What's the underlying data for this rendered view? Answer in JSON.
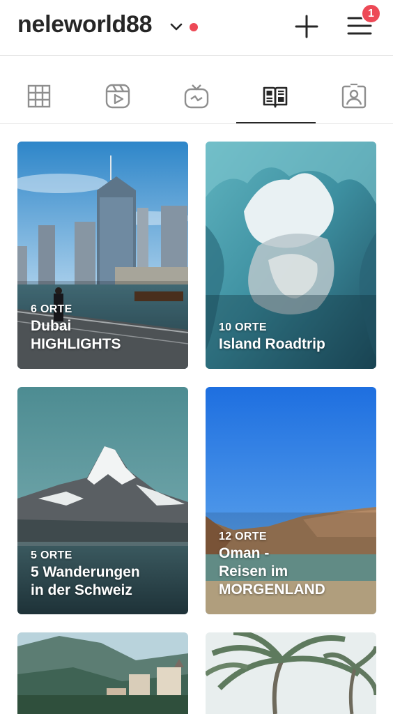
{
  "header": {
    "username": "neleworld88",
    "notification_count": "1"
  },
  "tabs": [
    {
      "name": "grid"
    },
    {
      "name": "reels"
    },
    {
      "name": "igtv"
    },
    {
      "name": "guides",
      "active": true
    },
    {
      "name": "tagged"
    }
  ],
  "guides": [
    {
      "count": "6 ORTE",
      "title_lines": [
        "Dubai",
        "HIGHLIGHTS"
      ]
    },
    {
      "count": "10 ORTE",
      "title_lines": [
        "Island Roadtrip"
      ]
    },
    {
      "count": "5 ORTE",
      "title_lines": [
        "5 Wanderungen",
        "in der Schweiz"
      ]
    },
    {
      "count": "12 ORTE",
      "title_lines": [
        "Oman -",
        "Reisen im",
        "MORGENLAND"
      ]
    }
  ],
  "colors": {
    "accent_red": "#ed4956",
    "text": "#262626",
    "divider": "#e6e6e6"
  }
}
